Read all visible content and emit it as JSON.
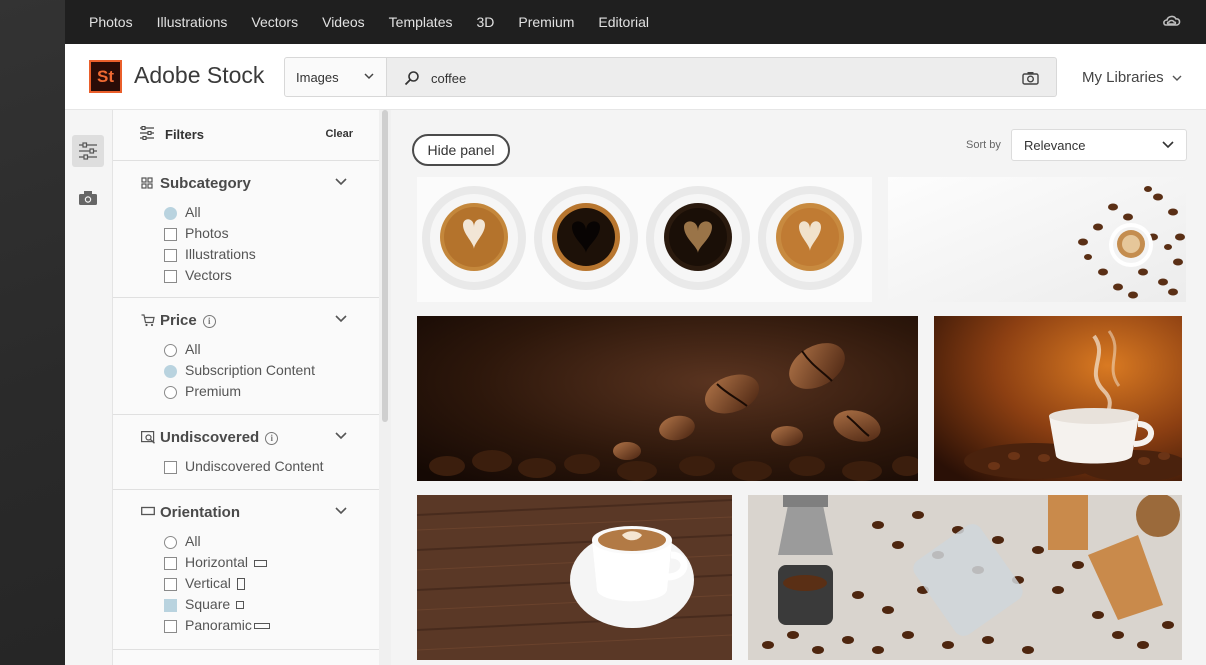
{
  "topnav": {
    "items": [
      "Photos",
      "Illustrations",
      "Vectors",
      "Videos",
      "Templates",
      "3D",
      "Premium",
      "Editorial"
    ],
    "cc_icon": "creative-cloud-icon"
  },
  "header": {
    "logo_text": "St",
    "brand": "Adobe Stock",
    "asset_type": "Images",
    "search_value": "coffee",
    "my_libraries": "My Libraries"
  },
  "filters": {
    "title": "Filters",
    "clear": "Clear",
    "sections": {
      "subcategory": {
        "title": "Subcategory",
        "options": [
          {
            "label": "All",
            "selected": true
          },
          {
            "label": "Photos",
            "selected": false
          },
          {
            "label": "Illustrations",
            "selected": false
          },
          {
            "label": "Vectors",
            "selected": false
          }
        ]
      },
      "price": {
        "title": "Price",
        "options": [
          {
            "label": "All",
            "selected": false
          },
          {
            "label": "Subscription Content",
            "selected": true
          },
          {
            "label": "Premium",
            "selected": false
          }
        ]
      },
      "undiscovered": {
        "title": "Undiscovered",
        "options": [
          {
            "label": "Undiscovered Content",
            "selected": false
          }
        ]
      },
      "orientation": {
        "title": "Orientation",
        "options": [
          {
            "label": "All",
            "selected": false
          },
          {
            "label": "Horizontal",
            "selected": false
          },
          {
            "label": "Vertical",
            "selected": false
          },
          {
            "label": "Square",
            "selected": true
          },
          {
            "label": "Panoramic",
            "selected": false
          }
        ]
      }
    }
  },
  "results": {
    "hide_panel": "Hide panel",
    "sort_by_label": "Sort by",
    "sort_value": "Relevance"
  },
  "colors": {
    "accent_selected": "#b9d3df",
    "logo_orange": "#ea5f2b",
    "nav_bg": "#1f1f1f"
  }
}
